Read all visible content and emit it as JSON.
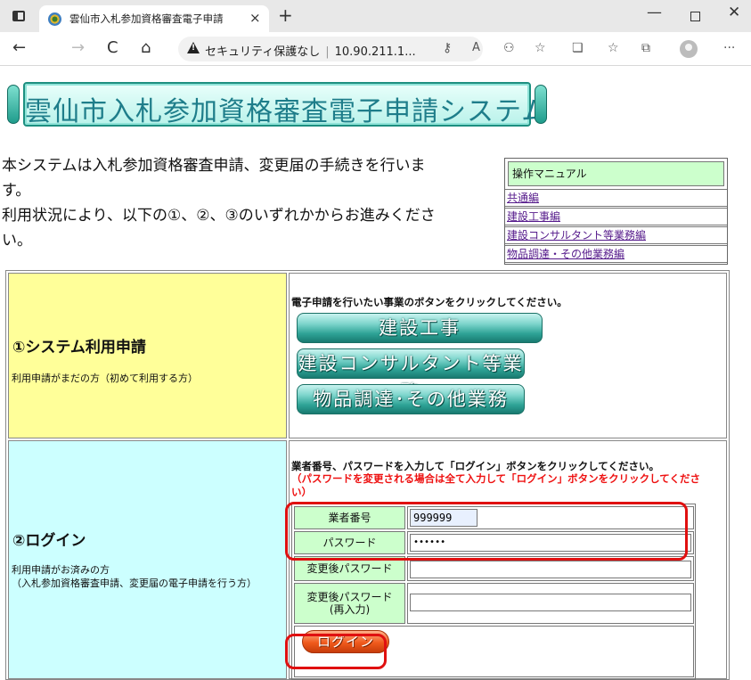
{
  "browser": {
    "tab_title": "雲仙市入札参加資格審査電子申請",
    "tab_close": "×",
    "new_tab": "+",
    "security_label": "セキュリティ保護なし",
    "url": "10.90.211.1...",
    "window": {
      "minimize": "—",
      "close": "✕"
    },
    "nav": {
      "back": "←",
      "forward": "→",
      "reload": "C",
      "home": "⌂"
    },
    "more": "···"
  },
  "page": {
    "banner_title": "雲仙市入札参加資格審査電子申請システム",
    "intro_line1": "本システムは入札参加資格審査申請、変更届の手続きを行いま",
    "intro_line2": "す。",
    "intro_line3": "利用状況により、以下の①、②、③のいずれかからお進みくださ",
    "intro_line4": "い。",
    "manual": {
      "header": "操作マニュアル",
      "links": [
        "共通編",
        "建設工事編",
        "建設コンサルタント等業務編",
        "物品調達・その他業務編"
      ]
    },
    "section1": {
      "title": "①システム利用申請",
      "desc": "利用申請がまだの方（初めて利用する方）",
      "instruction": "電子申請を行いたい事業のボタンをクリックしてください。",
      "buttons": [
        "建設工事",
        "建設コンサルタント等業務",
        "物品調達･その他業務"
      ]
    },
    "section2": {
      "title": "②ログイン",
      "desc_line1": "利用申請がお済みの方",
      "desc_line2": "（入札参加資格審査申請、変更届の電子申請を行う方）",
      "instruction": "業者番号、パスワードを入力して「ログイン」ボタンをクリックしてください。",
      "warning_line1": "（パスワードを変更される場合は全て入力して「ログイン」ボタンをクリックしてくださ",
      "warning_line2": "い）",
      "fields": {
        "vendor_no_label": "業者番号",
        "vendor_no_value": "999999",
        "password_label": "パスワード",
        "password_value": "••••••",
        "new_password_label": "変更後パスワード",
        "new_password_value": "",
        "new_password_confirm_label1": "変更後パスワード",
        "new_password_confirm_label2": "(再入力)",
        "new_password_confirm_value": ""
      },
      "login_button": "ログイン"
    }
  },
  "colors": {
    "highlight": "#e01010",
    "label_bg": "#ccffcc",
    "section1_bg": "#ffff99",
    "section2_bg": "#ccffff",
    "link": "#551a8b"
  }
}
